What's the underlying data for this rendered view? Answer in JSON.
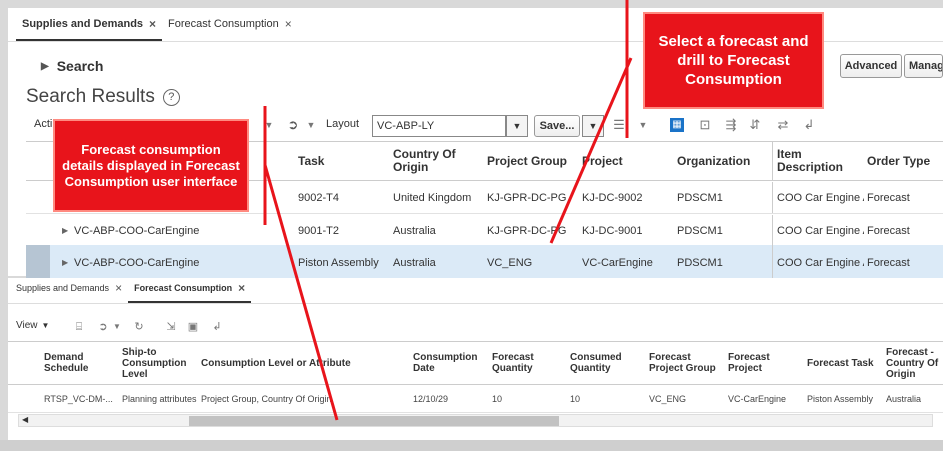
{
  "top": {
    "tabs": [
      {
        "label": "Supplies and Demands",
        "close": "×"
      },
      {
        "label": "Forecast Consumption",
        "close": "×"
      }
    ],
    "search_label": "Search",
    "results_title": "Search Results",
    "help": "?",
    "advanced_button": "Advanced",
    "manage_button": "Manag",
    "toolbar": {
      "actions_label": "Acti",
      "layout_label": "Layout",
      "layout_value": "VC-ABP-LY",
      "save_label": "Save..."
    },
    "columns": [
      "Task",
      "Country Of Origin",
      "Project Group",
      "Project",
      "Organization",
      "Item Description",
      "Order Type"
    ],
    "rows": [
      {
        "name": "",
        "task": "9002-T4",
        "country": "United Kingdom",
        "project_group": "KJ-GPR-DC-PG",
        "project": "KJ-DC-9002",
        "org": "PDSCM1",
        "item_desc": "COO Car Engine As",
        "order_type": "Forecast"
      },
      {
        "name": "VC-ABP-COO-CarEngine",
        "task": "9001-T2",
        "country": "Australia",
        "project_group": "KJ-GPR-DC-PG",
        "project": "KJ-DC-9001",
        "org": "PDSCM1",
        "item_desc": "COO Car Engine As",
        "order_type": "Forecast"
      },
      {
        "name": "VC-ABP-COO-CarEngine",
        "task": "Piston Assembly",
        "country": "Australia",
        "project_group": "VC_ENG",
        "project": "VC-CarEngine",
        "org": "PDSCM1",
        "item_desc": "COO Car Engine As",
        "order_type": "Forecast"
      }
    ]
  },
  "bottom": {
    "tabs": [
      {
        "label": "Supplies and Demands",
        "close": "×"
      },
      {
        "label": "Forecast Consumption",
        "close": "×"
      }
    ],
    "view_label": "View",
    "columns": [
      "Demand Schedule",
      "Ship-to Consumption Level",
      "Consumption Level or Attribute",
      "Consumption Date",
      "Forecast Quantity",
      "Consumed Quantity",
      "Forecast Project Group",
      "Forecast Project",
      "Forecast Task",
      "Forecast - Country Of Origin"
    ],
    "row": {
      "schedule": "RTSP_VC-DM-...",
      "level": "Planning attributes",
      "attribute": "Project Group, Country Of Origin",
      "date": "12/10/29",
      "fq": "10",
      "cq": "10",
      "fpg": "VC_ENG",
      "fp": "VC-CarEngine",
      "ft": "Piston Assembly",
      "fc": "Australia"
    }
  },
  "callouts": {
    "left": "Forecast consumption details displayed in Forecast Consumption user interface",
    "right": "Select a forecast and drill to Forecast Consumption"
  },
  "colors": {
    "callout": "#e8141b",
    "selected_row": "#dbeaf7",
    "leader_line": "#e8141b"
  }
}
